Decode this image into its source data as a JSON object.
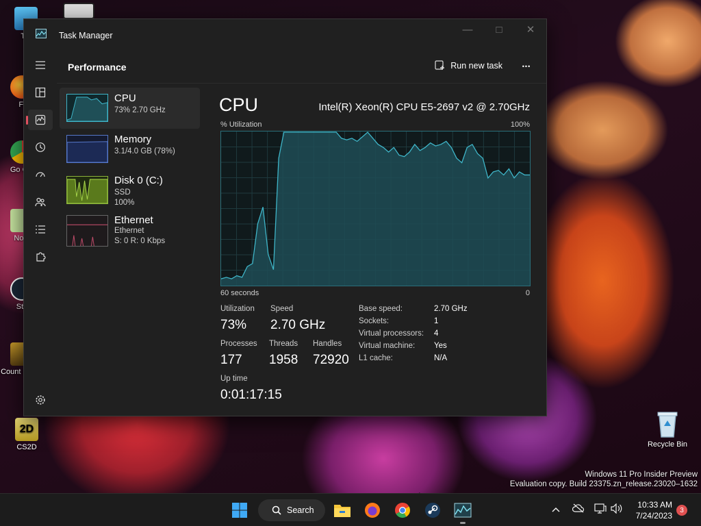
{
  "desktop": {
    "icons": [
      {
        "label": "Thi"
      },
      {
        "label": "Fi"
      },
      {
        "label": "Go Chi"
      },
      {
        "label": "Note"
      },
      {
        "label": "Ste"
      },
      {
        "label": "Count Globa"
      },
      {
        "label": "CS2D"
      }
    ],
    "recycle_bin": "Recycle Bin",
    "watermark": {
      "line1": "Windows 11 Pro Insider Preview",
      "line2": "Evaluation copy. Build 23375.zn_release.23020–1632"
    }
  },
  "window": {
    "title": "Task Manager",
    "controls": {
      "minimize": "—",
      "maximize": "□",
      "close": "✕"
    }
  },
  "header": {
    "page_title": "Performance",
    "run_task": "Run new task",
    "more": "•••"
  },
  "resources": [
    {
      "name": "CPU",
      "sub1": "73%  2.70 GHz",
      "sub2": "",
      "color": "#3fb6c9"
    },
    {
      "name": "Memory",
      "sub1": "3.1/4.0 GB (78%)",
      "sub2": "",
      "color": "#5577c9"
    },
    {
      "name": "Disk 0 (C:)",
      "sub1": "SSD",
      "sub2": "100%",
      "color": "#8bb33a"
    },
    {
      "name": "Ethernet",
      "sub1": "Ethernet",
      "sub2": "S: 0  R: 0 Kbps",
      "color": "#c04b6a"
    }
  ],
  "detail": {
    "title": "CPU",
    "model": "Intel(R) Xeon(R) CPU E5-2697 v2 @ 2.70GHz",
    "graph_top_left": "% Utilization",
    "graph_top_right": "100%",
    "graph_bottom_left": "60 seconds",
    "graph_bottom_right": "0",
    "utilization_label": "Utilization",
    "utilization": "73%",
    "speed_label": "Speed",
    "speed": "2.70 GHz",
    "processes_label": "Processes",
    "processes": "177",
    "threads_label": "Threads",
    "threads": "1958",
    "handles_label": "Handles",
    "handles": "72920",
    "uptime_label": "Up time",
    "uptime": "0:01:17:15",
    "specs": [
      {
        "k": "Base speed:",
        "v": "2.70 GHz"
      },
      {
        "k": "Sockets:",
        "v": "1"
      },
      {
        "k": "Virtual processors:",
        "v": "4"
      },
      {
        "k": "Virtual machine:",
        "v": "Yes"
      },
      {
        "k": "L1 cache:",
        "v": "N/A"
      }
    ],
    "utilization_history": [
      4,
      5,
      4,
      6,
      5,
      12,
      14,
      40,
      51,
      20,
      10,
      83,
      100,
      100,
      100,
      100,
      100,
      100,
      100,
      100,
      100,
      100,
      100,
      96,
      95,
      96,
      94,
      97,
      100,
      96,
      92,
      90,
      87,
      90,
      85,
      84,
      87,
      92,
      88,
      90,
      93,
      91,
      92,
      94,
      90,
      83,
      80,
      90,
      92,
      86,
      83,
      70,
      74,
      75,
      72,
      76,
      70,
      74,
      72,
      72
    ],
    "accent": "#3fb6c9"
  },
  "taskbar": {
    "search": "Search",
    "clock_time": "10:33 AM",
    "clock_date": "7/24/2023",
    "notifications": "3"
  }
}
